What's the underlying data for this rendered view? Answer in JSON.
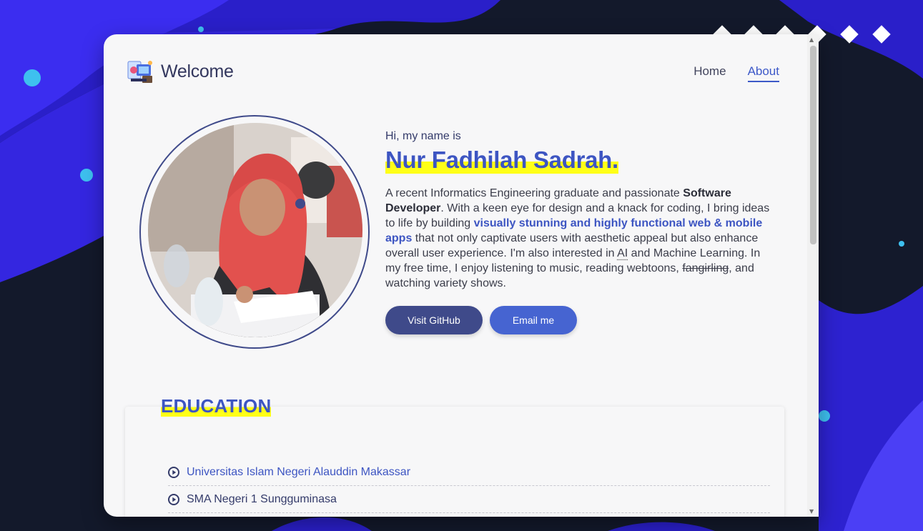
{
  "header": {
    "logo_text": "Welcome",
    "logo_icon": "workspace-illustration-icon"
  },
  "nav": {
    "items": [
      {
        "label": "Home",
        "active": false
      },
      {
        "label": "About",
        "active": true
      }
    ]
  },
  "intro": {
    "greeting": "Hi, my name is",
    "name": "Nur Fadhilah Sadrah.",
    "bio": {
      "p1": "A recent Informatics Engineering graduate and passionate ",
      "b1": "Software Developer",
      "p2": ". With a keen eye for design and a knack for coding, I bring ideas to life by building ",
      "hl": "visually stunning and highly functional web & mobile apps",
      "p3": " that not only captivate users with aesthetic appeal but also enhance overall user experience. I'm also interested in ",
      "abbr": "AI",
      "p4": " and Machine Learning. In my free time, I enjoy listening to music, reading webtoons, ",
      "strike": "fangirling",
      "p5": ", and watching variety shows."
    },
    "buttons": {
      "github": "Visit GitHub",
      "email": "Email me"
    }
  },
  "education": {
    "title": "EDUCATION",
    "items": [
      {
        "label": "Universitas Islam Negeri Alauddin Makassar"
      },
      {
        "label": "SMA Negeri 1 Sungguminasa"
      }
    ]
  },
  "colors": {
    "accent": "#3d55c2",
    "highlight": "#ffff17",
    "button_dark": "#3f4a8a",
    "button_blue": "#4664d1"
  }
}
